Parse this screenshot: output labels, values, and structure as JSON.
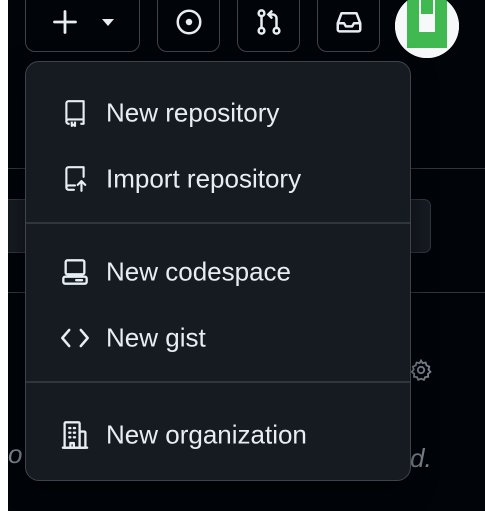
{
  "header": {
    "buttons": [
      {
        "name": "create-new",
        "icon": "plus-icon",
        "has_caret": true
      },
      {
        "name": "issues",
        "icon": "issue-opened-icon"
      },
      {
        "name": "pull-requests",
        "icon": "git-pull-request-icon"
      },
      {
        "name": "inbox",
        "icon": "inbox-icon"
      }
    ],
    "avatar": {
      "icon": "identicon",
      "color": "#3fb950"
    }
  },
  "menu": {
    "items": [
      {
        "label": "New repository",
        "icon": "repo-icon"
      },
      {
        "label": "Import repository",
        "icon": "repo-push-icon"
      },
      {
        "label": "New codespace",
        "icon": "codespaces-icon"
      },
      {
        "label": "New gist",
        "icon": "code-icon"
      },
      {
        "label": "New organization",
        "icon": "organization-icon"
      }
    ]
  },
  "background": {
    "left_fragment": "o",
    "right_fragment": "d."
  },
  "colors": {
    "page_bg": "#010409",
    "menu_bg": "#161b22",
    "border": "#3d444d",
    "text": "#e6edf3",
    "muted": "#7d8590",
    "accent_green": "#3fb950"
  }
}
